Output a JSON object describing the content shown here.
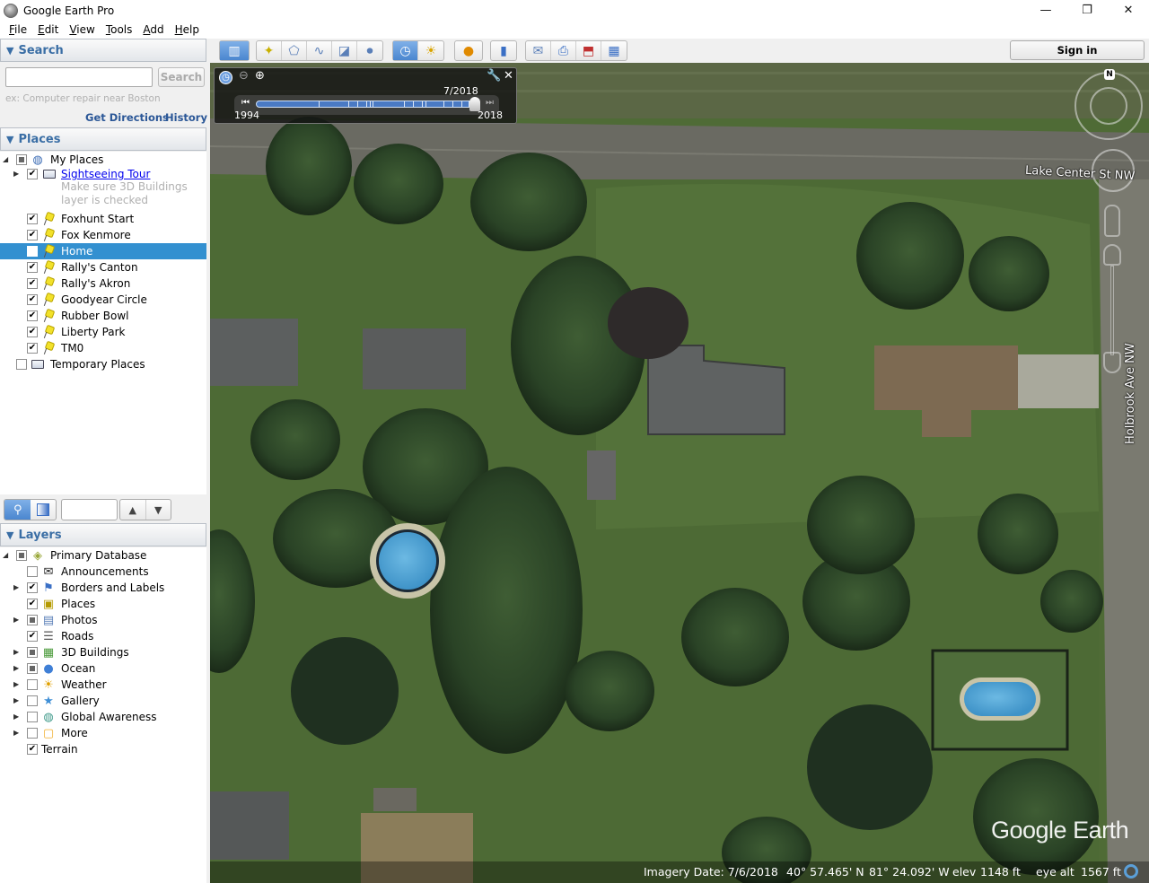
{
  "window": {
    "title": "Google Earth Pro",
    "controls": {
      "minimize": "—",
      "restore": "❐",
      "close": "✕"
    }
  },
  "menu": [
    {
      "label": "File",
      "accel": "F",
      "rest": "ile"
    },
    {
      "label": "Edit",
      "accel": "E",
      "rest": "dit"
    },
    {
      "label": "View",
      "accel": "V",
      "rest": "iew"
    },
    {
      "label": "Tools",
      "accel": "T",
      "rest": "ools"
    },
    {
      "label": "Add",
      "accel": "A",
      "rest": "dd"
    },
    {
      "label": "Help",
      "accel": "H",
      "rest": "elp"
    }
  ],
  "search": {
    "header": "Search",
    "input_value": "",
    "button_label": "Search",
    "hint": "ex: Computer repair near Boston",
    "get_directions": "Get Directions",
    "history": "History"
  },
  "places": {
    "header": "Places",
    "root": {
      "label": "My Places",
      "state": "partial"
    },
    "items": [
      {
        "label": "Sightseeing Tour",
        "checked": true,
        "type": "folder",
        "link": true,
        "note_line1": "Make sure 3D Buildings",
        "note_line2": "layer is checked"
      },
      {
        "label": "Foxhunt Start",
        "checked": true,
        "type": "placemark"
      },
      {
        "label": "Fox Kenmore",
        "checked": true,
        "type": "placemark"
      },
      {
        "label": "Home",
        "checked": false,
        "type": "placemark",
        "selected": true
      },
      {
        "label": "Rally's Canton",
        "checked": true,
        "type": "placemark"
      },
      {
        "label": "Rally's Akron",
        "checked": true,
        "type": "placemark"
      },
      {
        "label": "Goodyear Circle",
        "checked": true,
        "type": "placemark"
      },
      {
        "label": "Rubber Bowl",
        "checked": true,
        "type": "placemark"
      },
      {
        "label": "Liberty Park",
        "checked": true,
        "type": "placemark"
      },
      {
        "label": "TM0",
        "checked": true,
        "type": "placemark"
      }
    ],
    "temporary": {
      "label": "Temporary Places",
      "checked": false
    }
  },
  "layers": {
    "header": "Layers",
    "root": {
      "label": "Primary Database",
      "state": "partial"
    },
    "items": [
      {
        "label": "Announcements",
        "state": "unchecked",
        "icon": "envelope-icon",
        "glyph": "✉",
        "expandable": false
      },
      {
        "label": "Borders and Labels",
        "state": "checked",
        "icon": "flag-icon",
        "glyph": "⚑",
        "expandable": true
      },
      {
        "label": "Places",
        "state": "checked",
        "icon": "places-icon",
        "glyph": "▣",
        "expandable": false
      },
      {
        "label": "Photos",
        "state": "partial",
        "icon": "photos-icon",
        "glyph": "▤",
        "expandable": true
      },
      {
        "label": "Roads",
        "state": "checked",
        "icon": "roads-icon",
        "glyph": "☰",
        "expandable": false
      },
      {
        "label": "3D Buildings",
        "state": "partial",
        "icon": "building-icon",
        "glyph": "▦",
        "expandable": true
      },
      {
        "label": "Ocean",
        "state": "partial",
        "icon": "ocean-icon",
        "glyph": "●",
        "expandable": true
      },
      {
        "label": "Weather",
        "state": "unchecked",
        "icon": "sun-icon",
        "glyph": "☀",
        "expandable": true
      },
      {
        "label": "Gallery",
        "state": "unchecked",
        "icon": "star-icon",
        "glyph": "★",
        "expandable": true
      },
      {
        "label": "Global Awareness",
        "state": "unchecked",
        "icon": "globe-icon",
        "glyph": "◍",
        "expandable": true
      },
      {
        "label": "More",
        "state": "unchecked",
        "icon": "note-icon",
        "glyph": "▢",
        "expandable": true
      }
    ],
    "terrain": {
      "label": "Terrain",
      "state": "checked"
    }
  },
  "toolbar": {
    "sign_in": "Sign in",
    "groups": [
      [
        {
          "name": "sidebar-toggle",
          "glyph": "▥",
          "on": true
        }
      ],
      [
        {
          "name": "add-placemark",
          "glyph": "📌"
        },
        {
          "name": "add-polygon",
          "glyph": "⬠"
        },
        {
          "name": "add-path",
          "glyph": "∿"
        },
        {
          "name": "add-image-overlay",
          "glyph": "◪"
        },
        {
          "name": "record-tour",
          "glyph": "⏺"
        }
      ],
      [
        {
          "name": "historical-imagery",
          "glyph": "🕓",
          "on": true
        },
        {
          "name": "sunlight",
          "glyph": "☀"
        }
      ],
      [
        {
          "name": "switch-planet",
          "glyph": "🪐"
        }
      ],
      [
        {
          "name": "ruler",
          "glyph": "📏"
        }
      ],
      [
        {
          "name": "email",
          "glyph": "✉"
        },
        {
          "name": "print",
          "glyph": "🖶"
        },
        {
          "name": "save-image",
          "glyph": "⬒"
        },
        {
          "name": "view-in-maps",
          "glyph": "▦"
        }
      ]
    ]
  },
  "time_slider": {
    "current": "7/2018",
    "start": "1994",
    "end": "2018",
    "position_fraction": 1.0,
    "tick_fractions": [
      0.28,
      0.41,
      0.45,
      0.49,
      0.51,
      0.52,
      0.66,
      0.7,
      0.74,
      0.76,
      0.84,
      0.88,
      0.92,
      0.95
    ]
  },
  "map": {
    "street_labels": [
      "Lake Center St NW",
      "Holbrook Ave NW"
    ],
    "compass_label": "N",
    "logo": "Google Earth"
  },
  "status": {
    "imagery_date": "Imagery Date: 7/6/2018",
    "latitude": "40° 57.465' N",
    "longitude": "81° 24.092' W",
    "elevation_label": "elev",
    "elevation": "1148 ft",
    "eye_alt_label": "eye alt",
    "eye_alt": "1567 ft"
  },
  "colors": {
    "accent": "#3390d0",
    "header_text": "#3a6ea5",
    "link": "#2b5797",
    "slider_blue": "#4a7ac4"
  }
}
